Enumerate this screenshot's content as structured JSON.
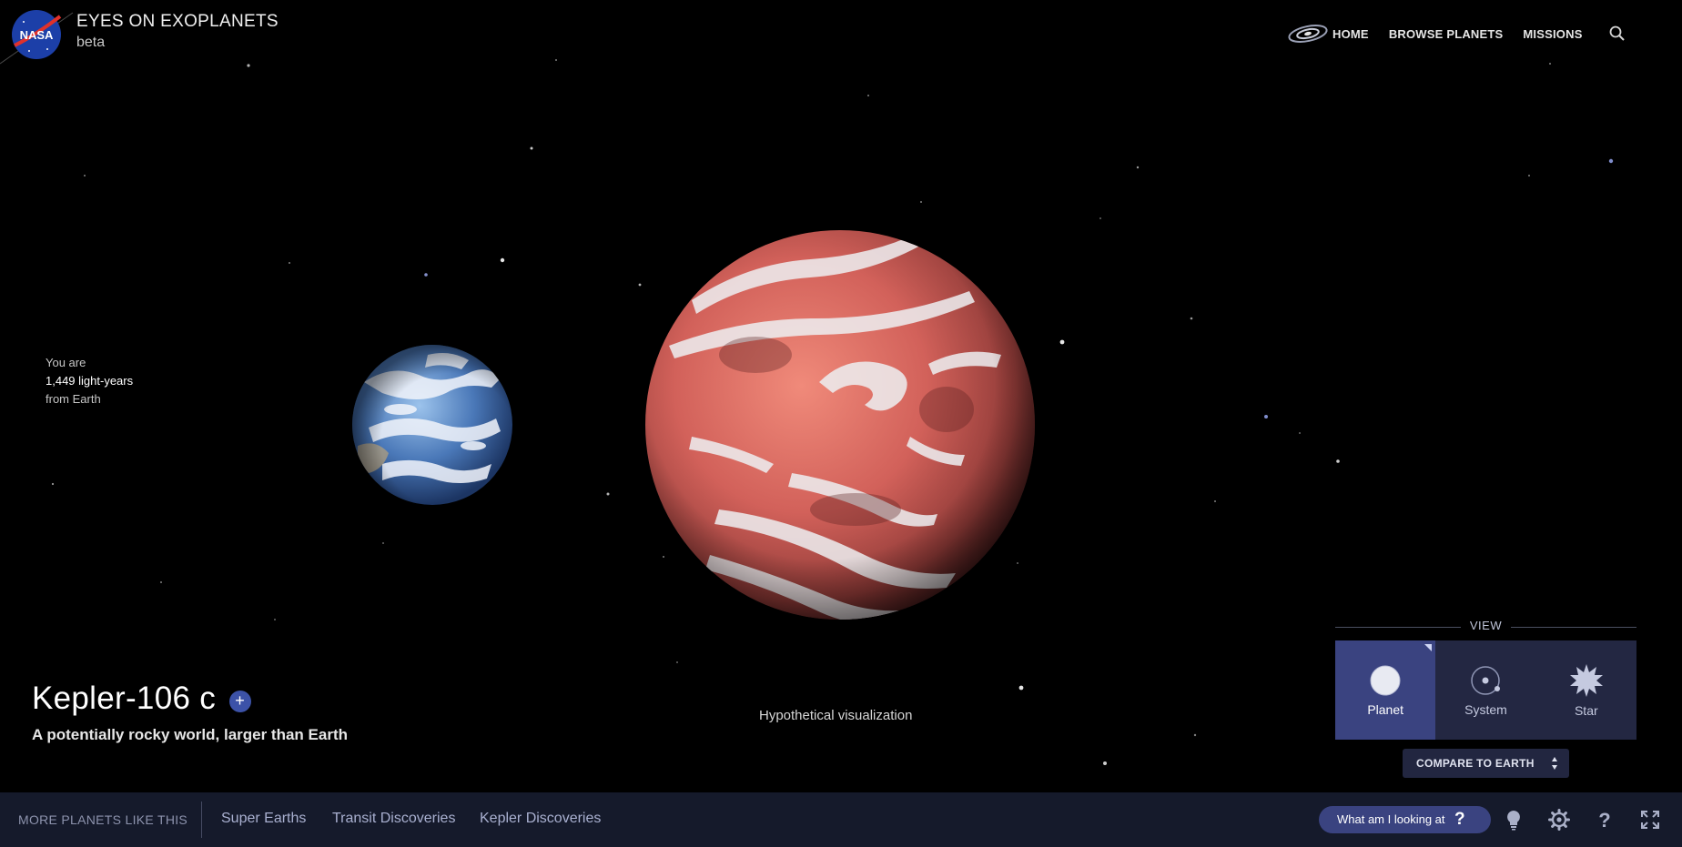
{
  "app": {
    "title": "EYES ON EXOPLANETS",
    "subtitle": "beta",
    "logo_text": "NASA"
  },
  "nav": {
    "items": [
      {
        "label": "HOME",
        "icon": "galaxy-icon"
      },
      {
        "label": "BROWSE PLANETS"
      },
      {
        "label": "MISSIONS"
      }
    ],
    "search_icon": "search-icon"
  },
  "distance": {
    "line1": "You are",
    "line2": "1,449 light-years",
    "line3": "from Earth"
  },
  "planet": {
    "name": "Kepler-106 c",
    "add_label": "+",
    "description": "A potentially rocky world, larger than Earth",
    "visualization_note": "Hypothetical visualization"
  },
  "view": {
    "label": "VIEW",
    "options": [
      {
        "label": "Planet",
        "icon": "planet-icon",
        "active": true
      },
      {
        "label": "System",
        "icon": "system-icon",
        "active": false
      },
      {
        "label": "Star",
        "icon": "star-icon",
        "active": false
      }
    ],
    "compare_label": "COMPARE TO EARTH"
  },
  "bottom": {
    "title": "MORE PLANETS LIKE THIS",
    "links": [
      "Super Earths",
      "Transit Discoveries",
      "Kepler Discoveries"
    ],
    "help_label": "What am I looking at",
    "help_q": "?",
    "icons": [
      "lightbulb-icon",
      "gear-icon",
      "help-icon",
      "fullscreen-icon"
    ]
  },
  "colors": {
    "background": "#000000",
    "accent": "#3a4380",
    "bar": "#151a2b",
    "planet_red": "#d9685c",
    "earth_blue": "#4a78b8"
  }
}
